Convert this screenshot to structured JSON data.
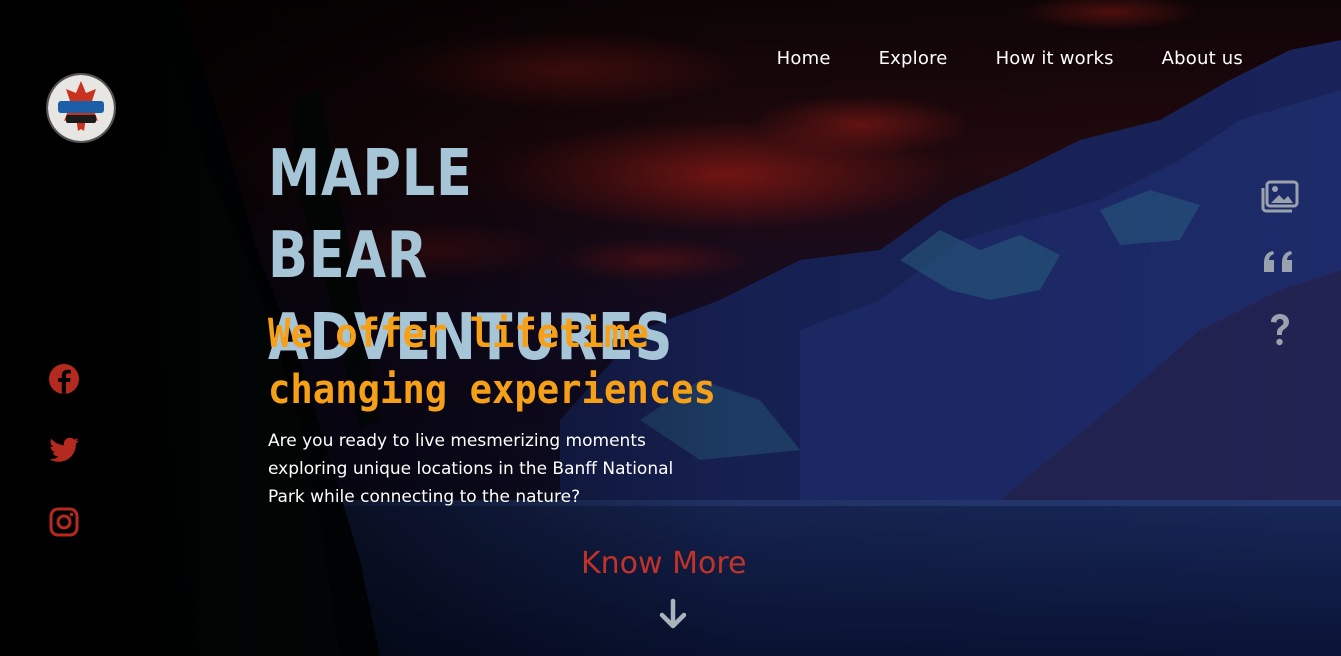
{
  "nav": {
    "items": [
      {
        "label": "Home"
      },
      {
        "label": "Explore"
      },
      {
        "label": "How it works"
      },
      {
        "label": "About us"
      }
    ]
  },
  "logo": {
    "text": "MAPLE BEAR"
  },
  "hero": {
    "title": "MAPLE BEAR ADVENTURES",
    "tagline": "We offer lifetime changing experiences",
    "description": "Are you ready to live mesmerizing moments exploring unique locations in the Banff National Park while connecting to the nature?",
    "cta_label": "Know More"
  },
  "social": {
    "icons": [
      "facebook-icon",
      "twitter-icon",
      "instagram-icon"
    ],
    "color": "#b52a1f"
  },
  "side_icons": [
    "gallery-icon",
    "quote-icon",
    "question-icon"
  ],
  "colors": {
    "title": "#a6c6d8",
    "tagline": "#f5a017",
    "cta": "#c0332a"
  }
}
